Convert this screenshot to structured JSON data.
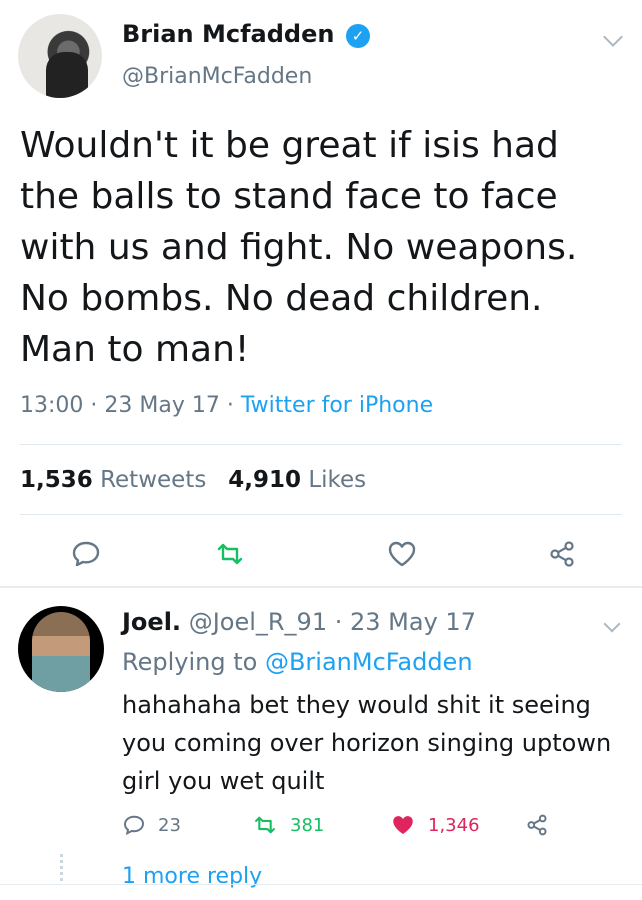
{
  "main_tweet": {
    "name": "Brian Mcfadden",
    "handle": "@BrianMcFadden",
    "text": "Wouldn't it be great if isis had the balls to stand face to face with us and fight. No weapons. No bombs. No dead children. Man to man!",
    "time": "13:00",
    "date": "23 May 17",
    "source": "Twitter for iPhone",
    "retweets_count": "1,536",
    "retweets_label": "Retweets",
    "likes_count": "4,910",
    "likes_label": "Likes"
  },
  "reply_tweet": {
    "name": "Joel.",
    "handle": "@Joel_R_91",
    "date": "23 May 17",
    "replying_prefix": "Replying to",
    "replying_to": "@BrianMcFadden",
    "text": "hahahaha bet they would shit it seeing you coming over horizon singing uptown girl you wet quilt",
    "reply_count": "23",
    "retweet_count": "381",
    "like_count": "1,346",
    "more_replies": "1 more reply"
  },
  "colors": {
    "accent": "#1da1f2",
    "secondary_text": "#657786",
    "retweet_green": "#17bf63",
    "like_red": "#e0245e"
  }
}
